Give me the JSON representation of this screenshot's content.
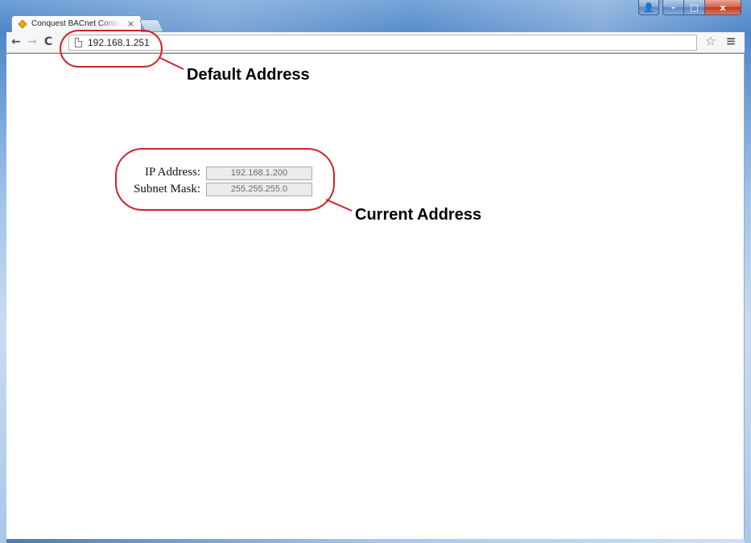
{
  "window": {
    "caption_buttons": {
      "user": "👤",
      "minimize": "–",
      "maximize": "□",
      "close": "x"
    }
  },
  "tab": {
    "title": "Conquest BACnet Control",
    "close": "×"
  },
  "toolbar": {
    "back": "←",
    "forward": "→",
    "reload": "C",
    "url": "192.168.1.251",
    "star": "☆",
    "menu": "≡"
  },
  "form": {
    "ip_label": "IP Address:",
    "ip_value": "192.168.1.200",
    "mask_label": "Subnet Mask:",
    "mask_value": "255.255.255.0"
  },
  "annotations": {
    "default_address": "Default Address",
    "current_address": "Current Address",
    "color": "#d0222c"
  }
}
